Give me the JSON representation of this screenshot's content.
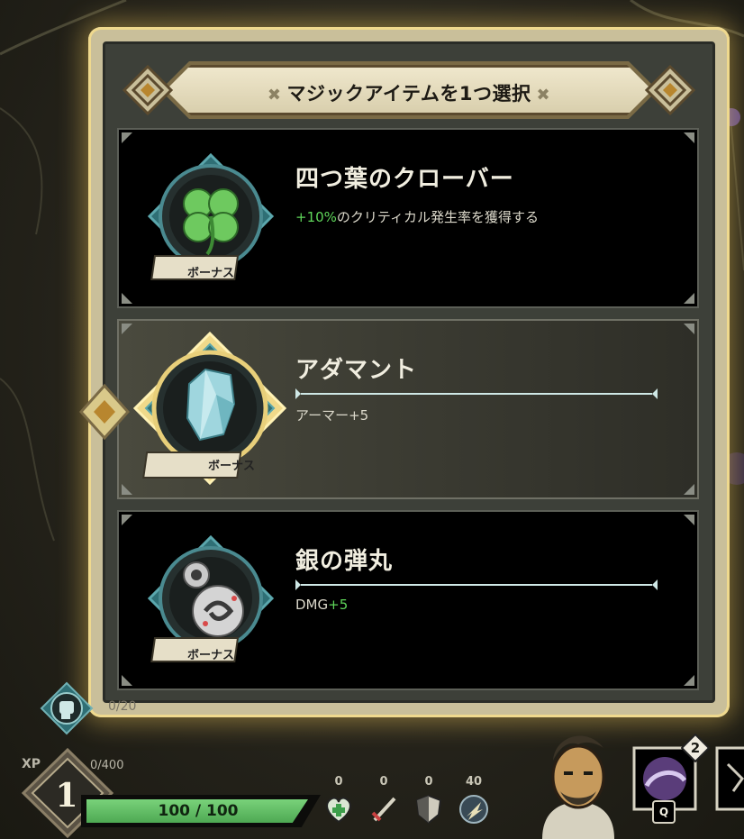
{
  "modal": {
    "title": "マジックアイテムを1つ選択"
  },
  "items": [
    {
      "name": "四つ葉のクローバー",
      "desc_prefix": "+10%",
      "desc_suffix": "のクリティカル発生率を獲得する",
      "tag": "ボーナス",
      "icon": "four-leaf-clover-icon",
      "selected": false
    },
    {
      "name": "アダマント",
      "desc_prefix": "アーマー+5",
      "desc_suffix": "",
      "tag": "ボーナス",
      "icon": "adamant-crystal-icon",
      "selected": true
    },
    {
      "name": "銀の弾丸",
      "desc_prefix": "DMG",
      "desc_suffix": "+5",
      "tag": "ボーナス",
      "icon": "silver-bullet-icon",
      "selected": false
    }
  ],
  "hud": {
    "xp_label": "XP",
    "xp_count": "0/400",
    "level": "1",
    "hp_text": "100 / 100",
    "hp_fraction": 1.0,
    "ghost_text": "0/20",
    "stats": [
      {
        "name": "heal",
        "value": "0",
        "icon": "heal-cross-icon"
      },
      {
        "name": "attack",
        "value": "0",
        "icon": "sword-icon"
      },
      {
        "name": "armor",
        "value": "0",
        "icon": "shield-icon"
      },
      {
        "name": "speed",
        "value": "40",
        "icon": "speed-boot-icon"
      }
    ],
    "ability_count": "2",
    "ability_key": "Q"
  },
  "colors": {
    "accent_gold": "#efd98e",
    "positive": "#5fd65a",
    "hp_green": "#4ea953"
  }
}
